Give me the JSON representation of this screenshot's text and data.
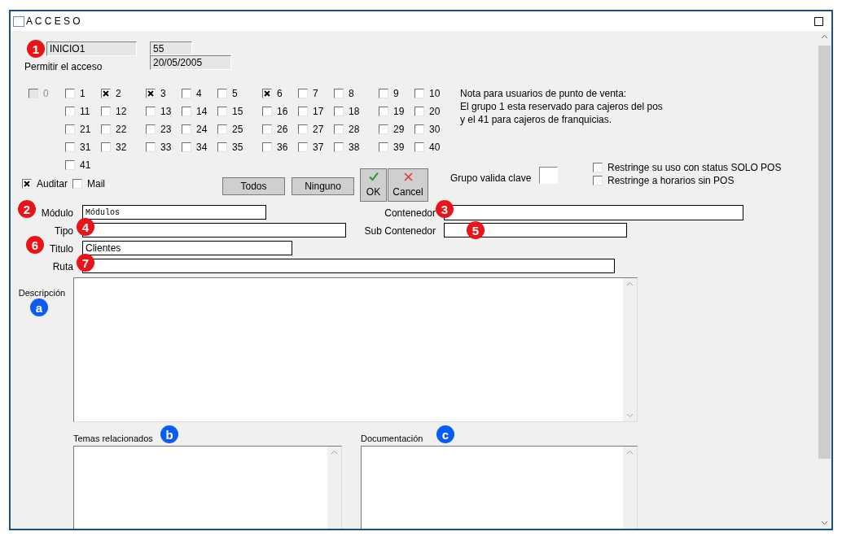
{
  "window": {
    "title": "A C C E S O"
  },
  "header": {
    "name": "INICIO1",
    "number": "55",
    "date": "20/05/2005",
    "caption": "Permitir el acceso",
    "callout": "1"
  },
  "groups": [
    {
      "label": "0",
      "checked": false,
      "disabled": true
    },
    {
      "label": "1",
      "checked": false,
      "disabled": false
    },
    {
      "label": "2",
      "checked": true,
      "disabled": false
    },
    {
      "label": "3",
      "checked": true,
      "disabled": false
    },
    {
      "label": "4",
      "checked": false,
      "disabled": false
    },
    {
      "label": "5",
      "checked": false,
      "disabled": false
    },
    {
      "label": "6",
      "checked": true,
      "disabled": false
    },
    {
      "label": "7",
      "checked": false,
      "disabled": false
    },
    {
      "label": "8",
      "checked": false,
      "disabled": false
    },
    {
      "label": "9",
      "checked": false,
      "disabled": false
    },
    {
      "label": "10",
      "checked": false,
      "disabled": false
    },
    {
      "label": "11",
      "checked": false,
      "disabled": false
    },
    {
      "label": "12",
      "checked": false,
      "disabled": false
    },
    {
      "label": "13",
      "checked": false,
      "disabled": false
    },
    {
      "label": "14",
      "checked": false,
      "disabled": false
    },
    {
      "label": "15",
      "checked": false,
      "disabled": false
    },
    {
      "label": "16",
      "checked": false,
      "disabled": false
    },
    {
      "label": "17",
      "checked": false,
      "disabled": false
    },
    {
      "label": "18",
      "checked": false,
      "disabled": false
    },
    {
      "label": "19",
      "checked": false,
      "disabled": false
    },
    {
      "label": "20",
      "checked": false,
      "disabled": false
    },
    {
      "label": "21",
      "checked": false,
      "disabled": false
    },
    {
      "label": "22",
      "checked": false,
      "disabled": false
    },
    {
      "label": "23",
      "checked": false,
      "disabled": false
    },
    {
      "label": "24",
      "checked": false,
      "disabled": false
    },
    {
      "label": "25",
      "checked": false,
      "disabled": false
    },
    {
      "label": "26",
      "checked": false,
      "disabled": false
    },
    {
      "label": "27",
      "checked": false,
      "disabled": false
    },
    {
      "label": "28",
      "checked": false,
      "disabled": false
    },
    {
      "label": "29",
      "checked": false,
      "disabled": false
    },
    {
      "label": "30",
      "checked": false,
      "disabled": false
    },
    {
      "label": "31",
      "checked": false,
      "disabled": false
    },
    {
      "label": "32",
      "checked": false,
      "disabled": false
    },
    {
      "label": "33",
      "checked": false,
      "disabled": false
    },
    {
      "label": "34",
      "checked": false,
      "disabled": false
    },
    {
      "label": "35",
      "checked": false,
      "disabled": false
    },
    {
      "label": "36",
      "checked": false,
      "disabled": false
    },
    {
      "label": "37",
      "checked": false,
      "disabled": false
    },
    {
      "label": "38",
      "checked": false,
      "disabled": false
    },
    {
      "label": "39",
      "checked": false,
      "disabled": false
    },
    {
      "label": "40",
      "checked": false,
      "disabled": false
    },
    {
      "label": "41",
      "checked": false,
      "disabled": false
    }
  ],
  "note": [
    "Nota para usuarios de punto de venta:",
    "El grupo 1 esta reservado para cajeros del pos",
    "y el 41 para cajeros de franquicias."
  ],
  "options": [
    {
      "label": "Auditar",
      "checked": true
    },
    {
      "label": "Mail",
      "checked": false
    }
  ],
  "buttons": [
    {
      "label": "Todos"
    },
    {
      "label": "Ninguno"
    }
  ],
  "ok": {
    "label": "OK"
  },
  "cancel": {
    "label": "Cancel"
  },
  "grupo_valida_clave": {
    "label": "Grupo valida clave"
  },
  "restrictions": [
    {
      "label": "Restringe su uso con status  SOLO POS",
      "checked": false
    },
    {
      "label": "Restringe a horarios sin POS",
      "checked": false
    }
  ],
  "fields": [
    {
      "label": "Módulo",
      "value": "Módulos",
      "callout": "2"
    },
    {
      "label": "Contenedor",
      "callout": "3"
    },
    {
      "label": "Tipo",
      "callout": "4"
    },
    {
      "label": "Sub Contenedor",
      "callout": "5"
    },
    {
      "label": "Titulo",
      "value": "Clientes",
      "callout": "6"
    },
    {
      "label": "Ruta",
      "callout": "7"
    }
  ],
  "text_areas": [
    {
      "label": "Descripción",
      "callout": "a"
    },
    {
      "label": "Temas relacionados",
      "callout": "b"
    },
    {
      "label": "Documentación",
      "callout": "c"
    }
  ]
}
